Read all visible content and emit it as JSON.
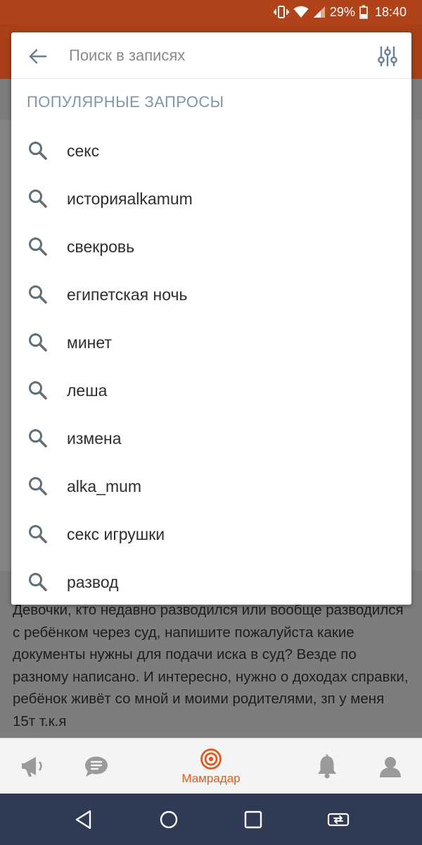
{
  "status_bar": {
    "battery": "29%",
    "time": "18:40",
    "icons": [
      "vibrate-icon",
      "wifi-icon",
      "signal-icon",
      "battery-icon"
    ]
  },
  "search": {
    "placeholder": "Поиск в записях",
    "value": "",
    "section_title": "ПОПУЛЯРНЫЕ ЗАПРОСЫ",
    "popular_queries": [
      "секс",
      "историяalkamum",
      "свекровь",
      "египетская ночь",
      "минет",
      "леша",
      "измена",
      "alka_mum",
      "секс игрушки",
      "развод"
    ]
  },
  "post": {
    "text": "Девочки, кто недавно разводился или вообще разводился с ребёнком через суд, напишите пожалуйста какие документы нужны для подачи иска в суд? Везде по разному написано. И интересно,  нужно о доходах справки, ребёнок живёт со мной и моими родителями, зп у меня 15т т.к.я"
  },
  "bottom_nav": {
    "items": [
      {
        "icon": "megaphone-icon"
      },
      {
        "icon": "chat-icon"
      },
      {
        "icon": "radar-icon",
        "label": "Мамрадар",
        "active": true
      },
      {
        "icon": "bell-icon"
      },
      {
        "icon": "profile-icon"
      }
    ]
  },
  "colors": {
    "accent": "#e2591d",
    "status_bar": "#b0431a",
    "section_title": "#7f97a8",
    "system_nav": "#2f3a55"
  }
}
